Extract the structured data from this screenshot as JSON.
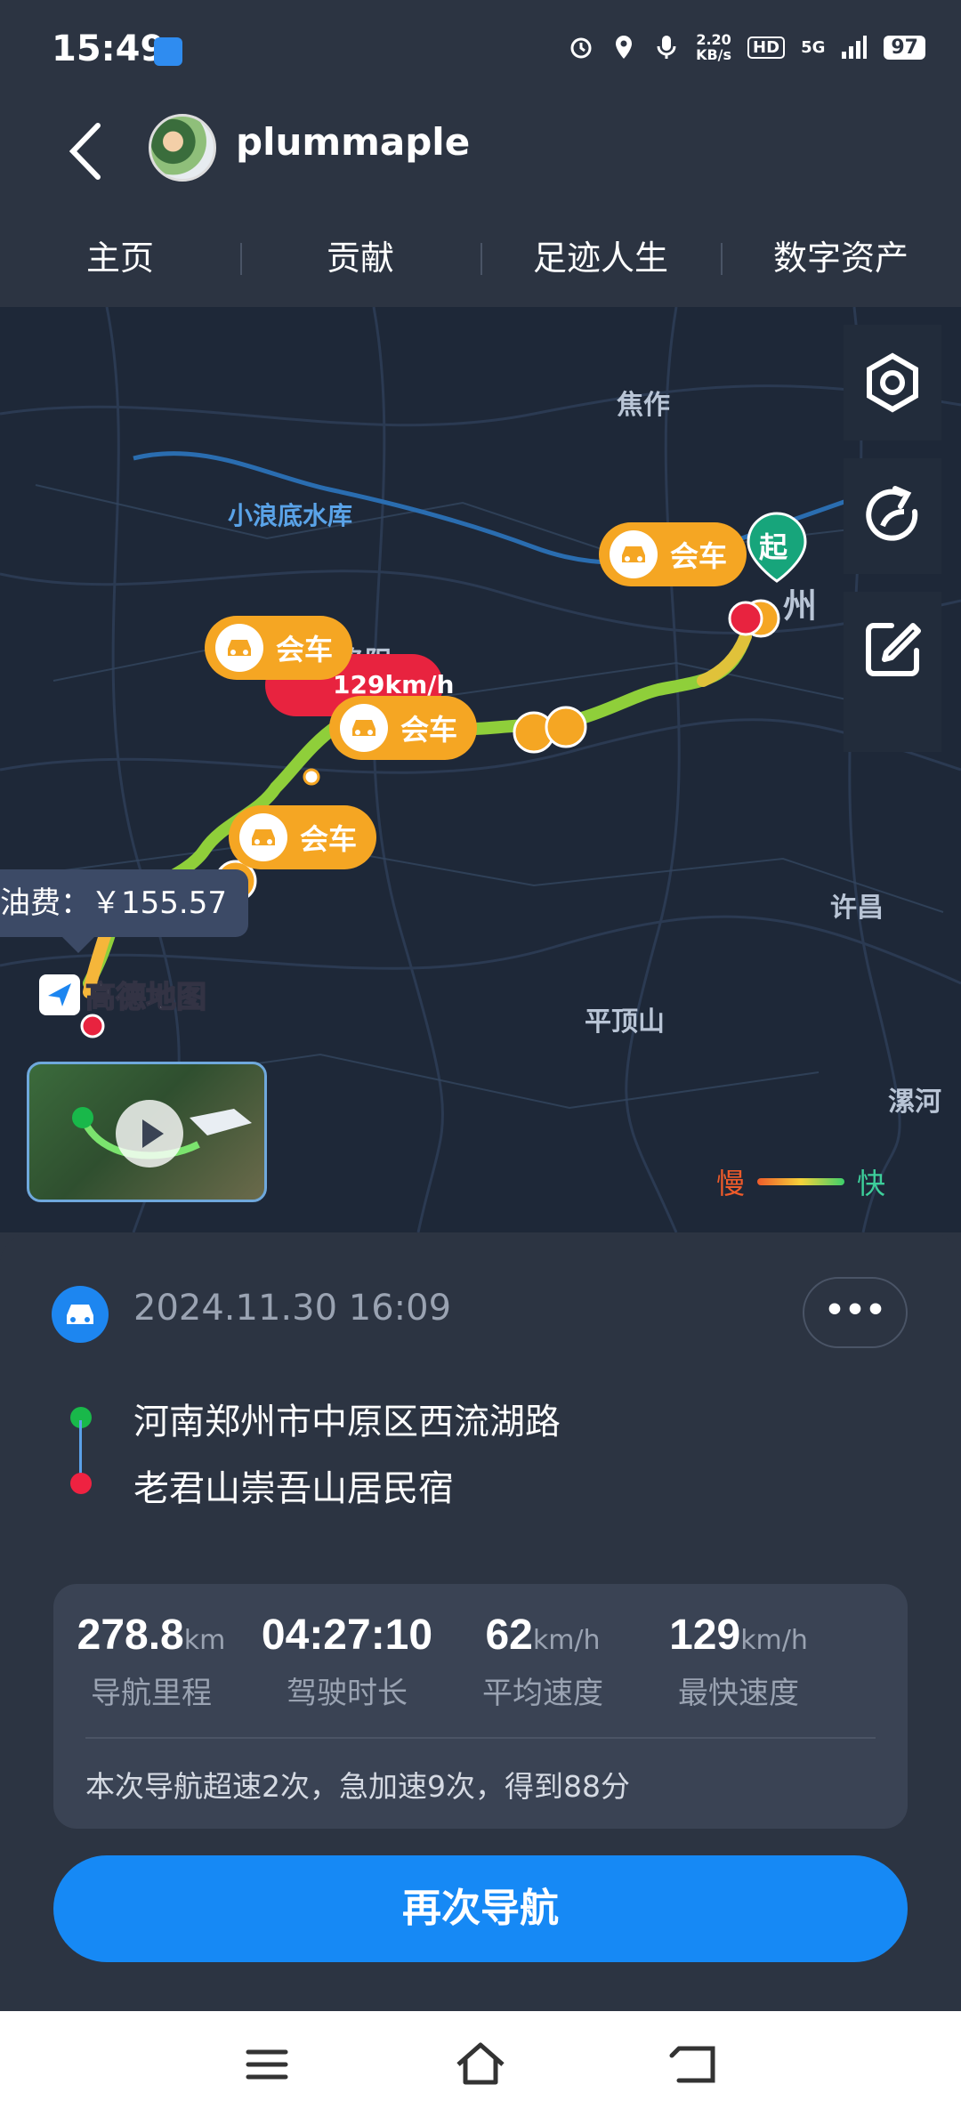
{
  "status_bar": {
    "time": "15:49",
    "net_speed_value": "2.20",
    "net_speed_unit": "KB/s",
    "hd": "HD",
    "network": "5G",
    "battery": "97"
  },
  "header": {
    "username": "plummaple"
  },
  "tabs": [
    "主页",
    "贡献",
    "足迹人生",
    "数字资产"
  ],
  "map": {
    "cities": {
      "jiaozuo": "焦作",
      "zhengzhou_partial": "州",
      "luoyang_partial": "洛阳",
      "xuchang": "许昌",
      "pingdingshan": "平顶山",
      "luohe": "漯河"
    },
    "reservoir": "小浪底水库",
    "meet_label": "会车",
    "speed_tag": "129km/h",
    "start_label": "起",
    "fuel_label": "油费：￥155.57",
    "logo_text": "高德地图",
    "legend_slow": "慢",
    "legend_fast": "快",
    "colors": {
      "route_slow": "#ef5b2a",
      "route_mid": "#f5d23a",
      "route_fast": "#3dcf6b",
      "meet": "#f5a623",
      "speeding": "#e8233f"
    }
  },
  "trip": {
    "datetime": "2024.11.30 16:09",
    "more": "•••",
    "origin": "河南郑州市中原区西流湖路",
    "destination": "老君山崇吾山居民宿"
  },
  "stats": [
    {
      "value": "278.8",
      "unit": "km",
      "label": "导航里程"
    },
    {
      "value": "04:27:10",
      "unit": "",
      "label": "驾驶时长"
    },
    {
      "value": "62",
      "unit": "km/h",
      "label": "平均速度"
    },
    {
      "value": "129",
      "unit": "km/h",
      "label": "最快速度"
    }
  ],
  "summary": "本次导航超速2次，急加速9次，得到88分",
  "renav_button": "再次导航"
}
